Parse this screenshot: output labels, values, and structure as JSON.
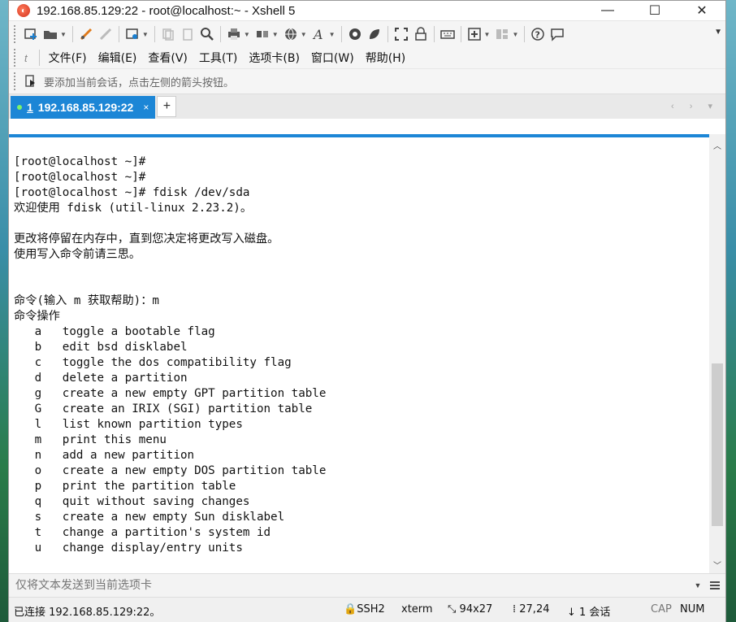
{
  "window": {
    "title": "192.168.85.129:22 - root@localhost:~ - Xshell 5",
    "minimize": "—",
    "maximize": "☐",
    "close": "✕"
  },
  "toolbar": {
    "icons": [
      "new-session-icon",
      "open-folder-icon",
      "connect-icon",
      "disconnect-icon",
      "properties-icon",
      "copy-icon",
      "paste-icon",
      "find-icon",
      "print-icon",
      "transfer-icon",
      "globe-icon",
      "font-icon",
      "xftp-icon",
      "xshell-icon",
      "fullscreen-icon",
      "lock-icon",
      "keyboard-icon",
      "add-icon",
      "layout-icon",
      "help-icon",
      "chat-icon"
    ]
  },
  "menubar": {
    "glyph": "t",
    "items": [
      "文件(F)",
      "编辑(E)",
      "查看(V)",
      "工具(T)",
      "选项卡(B)",
      "窗口(W)",
      "帮助(H)"
    ]
  },
  "hintbar": {
    "text": "要添加当前会话，点击左侧的箭头按钮。"
  },
  "tabs": [
    {
      "number": "1",
      "label": "192.168.85.129:22",
      "close": "×"
    }
  ],
  "tab_add": "+",
  "tab_nav": "‹ › ▾",
  "terminal": {
    "lines": [
      "[root@localhost ~]#",
      "[root@localhost ~]#",
      "[root@localhost ~]# fdisk /dev/sda",
      "欢迎使用 fdisk (util-linux 2.23.2)。",
      "",
      "更改将停留在内存中，直到您决定将更改写入磁盘。",
      "使用写入命令前请三思。",
      "",
      "",
      "命令(输入 m 获取帮助)：m",
      "命令操作",
      "   a   toggle a bootable flag",
      "   b   edit bsd disklabel",
      "   c   toggle the dos compatibility flag",
      "   d   delete a partition",
      "   g   create a new empty GPT partition table",
      "   G   create an IRIX (SGI) partition table",
      "   l   list known partition types",
      "   m   print this menu",
      "   n   add a new partition",
      "   o   create a new empty DOS partition table",
      "   p   print the partition table",
      "   q   quit without saving changes",
      "   s   create a new empty Sun disklabel",
      "   t   change a partition's system id",
      "   u   change display/entry units"
    ]
  },
  "sendbar": {
    "placeholder": "仅将文本发送到当前选项卡"
  },
  "status": {
    "connection": "已连接 192.168.85.129:22。",
    "protocol": "SSH2",
    "terminal_type": "xterm",
    "size": "94x27",
    "cursor": "27,24",
    "sessions": "1 会话",
    "cap": "CAP",
    "num": "NUM"
  },
  "colors": {
    "accent": "#1c86d6",
    "tab_dot": "#7cf26a"
  }
}
